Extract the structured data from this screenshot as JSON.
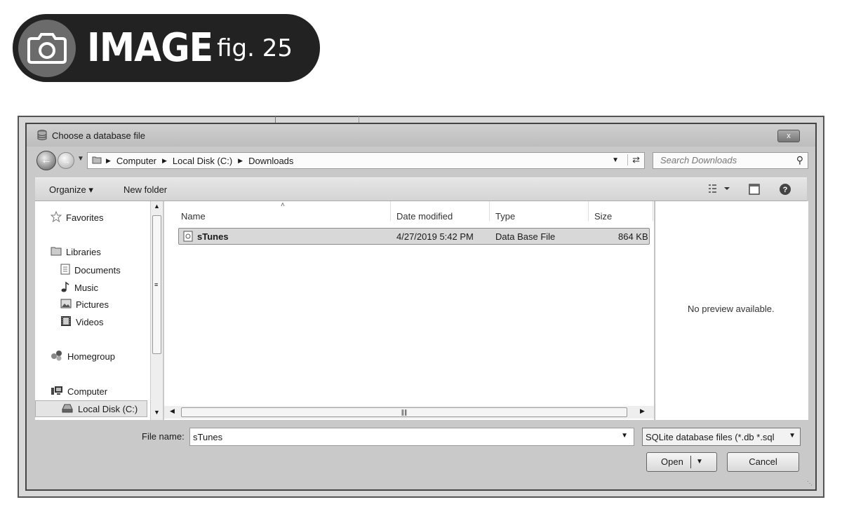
{
  "badge": {
    "title": "IMAGE",
    "fig": "fig. 25",
    "icon": "camera-icon"
  },
  "dialog": {
    "title": "Choose a database file",
    "title_icon": "database-icon",
    "close_label": "x"
  },
  "address": {
    "breadcrumbs": [
      "Computer",
      "Local Disk (C:)",
      "Downloads"
    ],
    "search_placeholder": "Search Downloads"
  },
  "toolbar": {
    "organize": "Organize ▾",
    "new_folder": "New folder"
  },
  "nav": {
    "favorites": "Favorites",
    "libraries": "Libraries",
    "documents": "Documents",
    "music": "Music",
    "pictures": "Pictures",
    "videos": "Videos",
    "homegroup": "Homegroup",
    "computer": "Computer",
    "local_disk": "Local Disk (C:)"
  },
  "files": {
    "columns": [
      "Name",
      "Date modified",
      "Type",
      "Size"
    ],
    "rows": [
      {
        "name": "sTunes",
        "date": "4/27/2019 5:42 PM",
        "type": "Data Base File",
        "size": "864 KB"
      }
    ]
  },
  "preview": {
    "message": "No preview available."
  },
  "bottom": {
    "file_name_label": "File name:",
    "file_name_value": "sTunes",
    "file_type": "SQLite database files (*.db *.sql",
    "open_label": "Open",
    "cancel_label": "Cancel"
  },
  "colors": {
    "accent": "#222222",
    "badge_icon_bg": "#6b6b6b",
    "selection": "#d8d8d8"
  }
}
